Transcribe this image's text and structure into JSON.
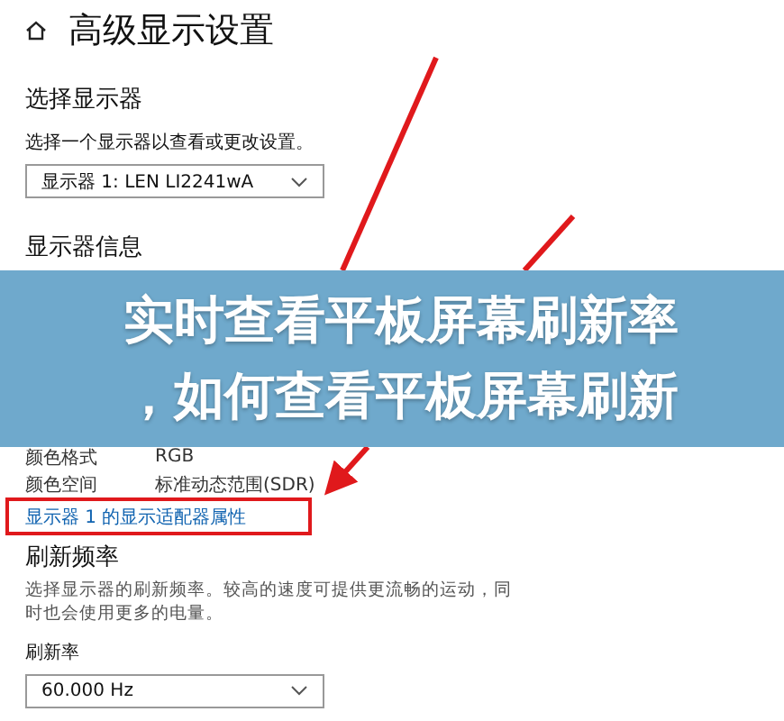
{
  "header": {
    "title": "高级显示设置"
  },
  "select_display": {
    "heading": "选择显示器",
    "hint": "选择一个显示器以查看或更改设置。",
    "dropdown": "显示器 1: LEN LI2241wA"
  },
  "display_info": {
    "heading": "显示器信息",
    "rows": [
      {
        "label": "颜色格式",
        "value": "RGB"
      },
      {
        "label": "颜色空间",
        "value": "标准动态范围(SDR)"
      }
    ],
    "link": "显示器 1 的显示适配器属性"
  },
  "refresh": {
    "heading": "刷新频率",
    "description": "选择显示器的刷新频率。较高的速度可提供更流畅的运动，同时也会使用更多的电量。",
    "label": "刷新率",
    "dropdown": "60.000 Hz"
  },
  "banner": {
    "lines": [
      "实时查看平板屏幕刷新率",
      "，如何查看平板屏幕刷新"
    ]
  }
}
